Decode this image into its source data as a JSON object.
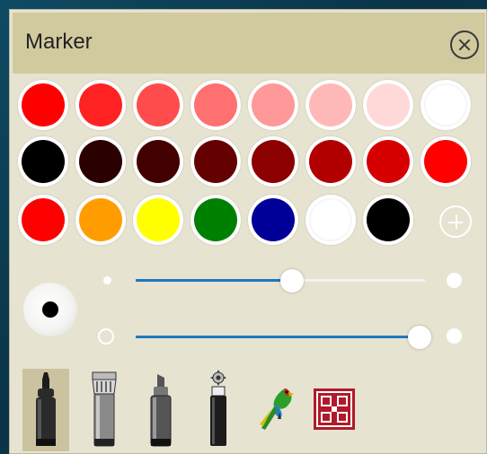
{
  "panel": {
    "title": "Marker",
    "close_icon": "close-circle-icon"
  },
  "palette": {
    "rows": [
      [
        "#ff0000",
        "#ff2222",
        "#ff4c4c",
        "#ff7070",
        "#ff9898",
        "#ffb8b8",
        "#ffd8d8",
        "#ffffff"
      ],
      [
        "#000000",
        "#2a0000",
        "#420000",
        "#650000",
        "#8d0000",
        "#b20000",
        "#d60000",
        "#ff0000"
      ],
      [
        "#ff0000",
        "#ff9d00",
        "#ffff00",
        "#008000",
        "#000099",
        "#ffffff",
        "#000000"
      ]
    ],
    "add_icon": "plus-circle-icon"
  },
  "preview": {
    "color": "#000000"
  },
  "sliders": {
    "size": {
      "value": 0.54,
      "min_icon": "small-dot-icon",
      "max_icon": "large-dot-icon"
    },
    "opacity": {
      "value": 0.98,
      "min_icon": "hollow-circle-icon",
      "max_icon": "solid-circle-icon"
    }
  },
  "tools": [
    {
      "name": "marker",
      "icon": "marker-pen-icon",
      "selected": true
    },
    {
      "name": "brush",
      "icon": "brush-marker-icon",
      "selected": false
    },
    {
      "name": "highlighter",
      "icon": "chisel-marker-icon",
      "selected": false
    },
    {
      "name": "special",
      "icon": "gear-marker-icon",
      "selected": false
    },
    {
      "name": "parrot",
      "icon": "parrot-icon",
      "selected": false
    },
    {
      "name": "pattern",
      "icon": "pattern-tile-icon",
      "selected": false
    }
  ],
  "accent": "#1e78c2"
}
